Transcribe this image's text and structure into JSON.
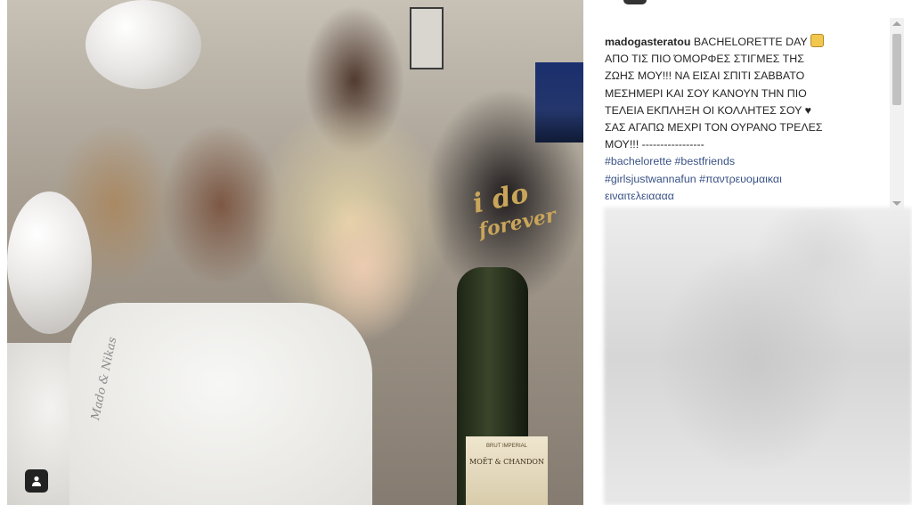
{
  "post": {
    "username": "madogasteratou",
    "caption_lines": [
      "BACHELORETTE DAY",
      "ΑΠΟ ΤΙΣ ΠΙΟ ΌΜΟΡΦΕΣ ΣΤΙΓΜΕΣ ΤΗΣ",
      "ΖΩΗΣ ΜΟΥ!!! ΝΑ ΕΙΣΑΙ ΣΠΙΤΙ ΣΑΒΒΑΤΟ",
      "ΜΕΣΗΜΕΡΙ ΚΑΙ ΣΟΥ ΚΑΝΟΥΝ ΤΗΝ ΠΙΟ",
      "ΤΕΛΕΙΑ ΕΚΠΛΗΞΗ ΟΙ ΚΟΛΛΗΤΕΣ ΣΟΥ ♥",
      "ΣΑΣ ΑΓΑΠΩ ΜΕΧΡΙ ΤΟΝ ΟΥΡΑΝΟ ΤΡΕΛΕΣ",
      "ΜΟΥ!!! -----------------"
    ],
    "hashtag_lines": [
      "#bachelorette #bestfriends",
      "#girlsjustwannafun #παντρευομαικαι",
      "ειναιτελειαααα"
    ],
    "emoji_icon": "wedding-emoji-icon"
  },
  "photo": {
    "shirt_text": "Mado & Nikas",
    "top_text": "i do",
    "top_text_2": "forever",
    "bottle_label": "MOËT & CHANDON",
    "bottle_sublabel": "BRUT IMPERIAL",
    "tagged_icon": "person-tag-icon"
  }
}
